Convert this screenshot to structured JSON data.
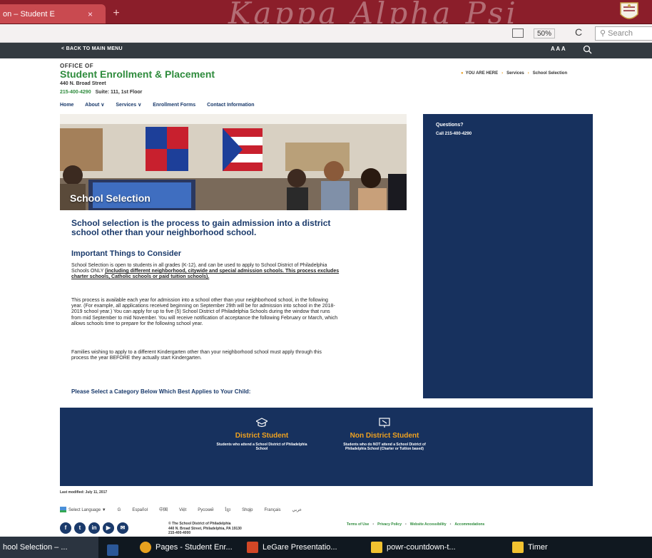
{
  "browser": {
    "tab_title": "on – Student E",
    "tab_close": "×",
    "new_tab": "+",
    "theme_text": "Kappa Alpha Psi",
    "zoom": "50%",
    "reload": "C",
    "search_placeholder": "Search"
  },
  "site_header": {
    "back_label": "< BACK TO MAIN MENU",
    "font_sizer": "A A A"
  },
  "office": {
    "office_of": "OFFICE OF",
    "title": "Student Enrollment & Placement",
    "address": "440 N. Broad Street",
    "phone": "215-400-4290",
    "suite": "Suite: 111, 1st Floor"
  },
  "breadcrumb": {
    "you_are_here": "YOU ARE HERE",
    "items": [
      "Services",
      "School Selection"
    ]
  },
  "menu": {
    "items": [
      "Home",
      "About ∨",
      "Services ∨",
      "Enrollment Forms",
      "Contact Information"
    ]
  },
  "hero": {
    "title": "School Selection"
  },
  "content": {
    "lead": "School selection is the process to gain admission into a district school other than your neighborhood school.",
    "heading": "Important Things to Consider",
    "p1_text": "School Selection is open to students in all grades (K-12), and can be used to apply to School District of Philadelphia Schools ONLY ",
    "p1_underlined": "(including different neighborhood, citywide and special admission schools. This process excludes charter schools, Catholic schools or paid tuition schools).",
    "p2": "This process is available each year for admission into a school other than your neighborhood school, in the following year. (For example, all applications received beginning on September 29th will be for admission into school in the 2018-2019 school year.) You can apply for up to five (5) School District of Philadelphia Schools during the window that runs from mid September to mid November. You will receive notification of acceptance the following February or March, which allows schools time to prepare for the following school year.",
    "p3": "Families wishing to apply to a different Kindergarten other than your neighborhood school must apply through this process the year BEFORE they actually start Kindergarten.",
    "select_category": "Please Select a Category Below Which Best Applies to Your Child:"
  },
  "sidebar": {
    "title": "Questions?",
    "call": "Call 215-400-4290"
  },
  "categories": [
    {
      "title": "District Student",
      "desc": "Students who attend a School District of Philadelphia School",
      "icon": "graduation-cap-icon"
    },
    {
      "title": "Non District Student",
      "desc": "Students who do NOT attend a School District of Philadelphia School (Charter or Tuition based)",
      "icon": "presentation-board-icon"
    }
  ],
  "footer": {
    "modified": "Last modified: July 11, 2017",
    "select_language": "Select Language ▼",
    "languages": [
      "Español",
      "中国",
      "Việt",
      "Русский",
      "ខ្មែរ",
      "Shqip",
      "Français",
      "عربي"
    ],
    "social": [
      "f",
      "t",
      "in",
      "▶",
      "✉"
    ],
    "district_name": "© The School District of Philadelphia",
    "district_address": "440 N. Broad Street, Philadelphia, PA 19130",
    "district_phone": "215-400-4000",
    "links": [
      "Terms of Use",
      "Privacy Policy",
      "Website Accessibility",
      "Accommodations"
    ]
  },
  "taskbar": {
    "items": [
      "hool Selection – ...",
      "Pages - Student Enr...",
      "LeGare Presentatio...",
      "powr-countdown-t...",
      "Timer"
    ]
  },
  "colors": {
    "tab_bar": "#8b1e2a",
    "navy": "#17315e",
    "green": "#2e8b3c",
    "orange": "#f0a21f"
  }
}
